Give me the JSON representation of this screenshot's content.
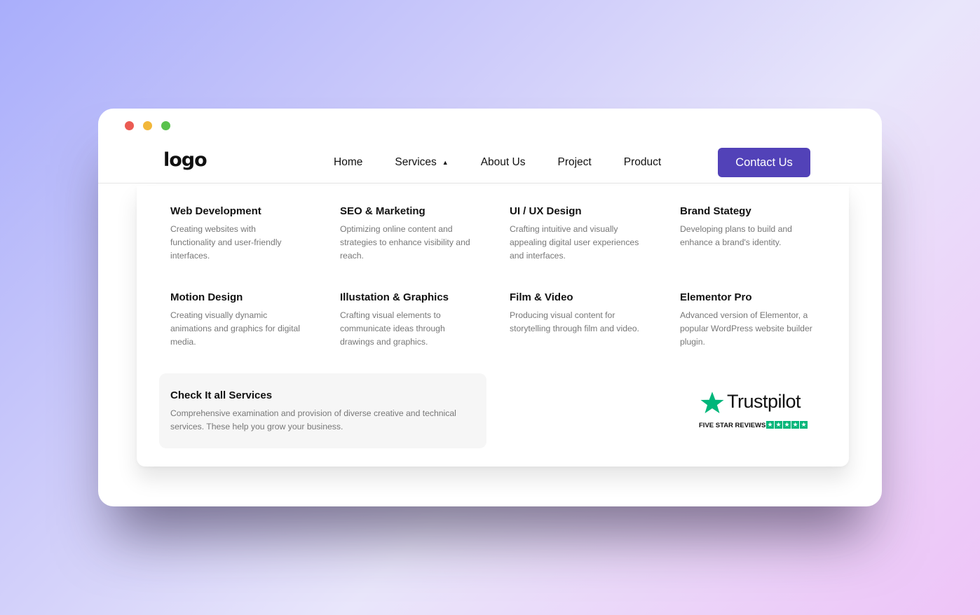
{
  "colors": {
    "accent": "#5242b8",
    "dot_red": "#eb5b53",
    "dot_yellow": "#f2b73a",
    "dot_green": "#5ac24d",
    "trustpilot_green": "#00b67a"
  },
  "header": {
    "logo": "logo",
    "nav": {
      "home": "Home",
      "services": "Services",
      "about": "About Us",
      "project": "Project",
      "product": "Product"
    },
    "contact_label": "Contact Us"
  },
  "services": [
    {
      "title": "Web Development",
      "desc": "Creating websites with functionality and user-friendly interfaces."
    },
    {
      "title": "SEO & Marketing",
      "desc": "Optimizing online content and strategies to enhance visibility and reach."
    },
    {
      "title": "UI / UX Design",
      "desc": "Crafting intuitive and visually appealing digital user experiences and interfaces."
    },
    {
      "title": "Brand Stategy",
      "desc": "Developing plans to build and enhance a brand's identity."
    },
    {
      "title": "Motion Design",
      "desc": "Creating visually dynamic animations and graphics for digital media."
    },
    {
      "title": "Illustation & Graphics",
      "desc": "Crafting visual elements to communicate ideas through drawings and graphics."
    },
    {
      "title": "Film & Video",
      "desc": "Producing visual content for storytelling through film and video."
    },
    {
      "title": "Elementor Pro",
      "desc": "Advanced version of Elementor, a popular WordPress website builder plugin."
    }
  ],
  "all_services": {
    "title": "Check It all Services",
    "desc": "Comprehensive examination and provision of diverse creative and technical services. These help you grow your business."
  },
  "trustpilot": {
    "brand": "Trustpilot",
    "tagline": "FIVE STAR REVIEWS",
    "stars": 5
  }
}
